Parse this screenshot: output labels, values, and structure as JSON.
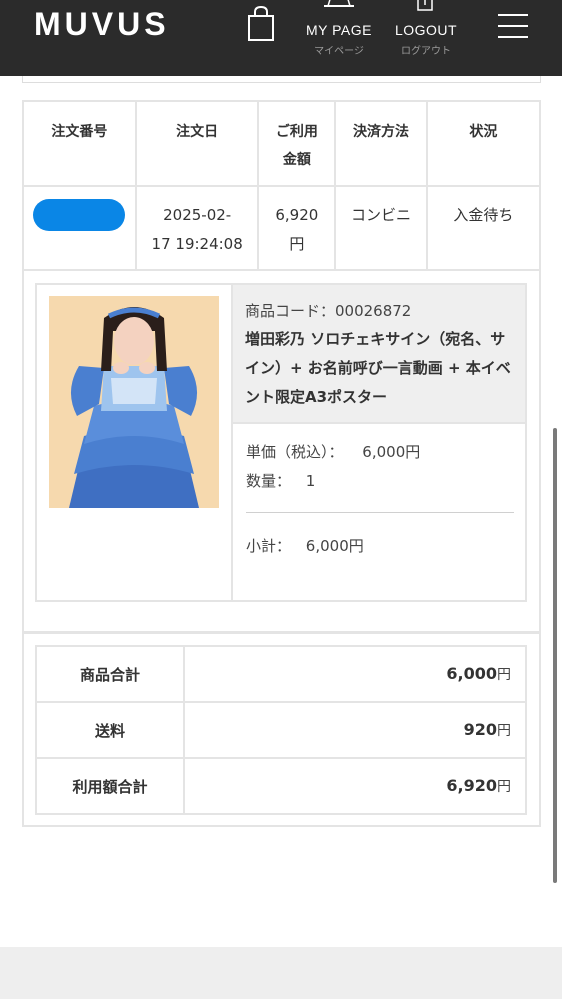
{
  "header": {
    "logo": "MUVUS",
    "mypage_en": "MY PAGE",
    "mypage_jp": "マイページ",
    "logout_en": "LOGOUT",
    "logout_jp": "ログアウト",
    "icons": [
      "shopping-bag-icon",
      "mypage-icon",
      "logout-icon",
      "hamburger-menu-icon"
    ]
  },
  "order": {
    "headers": [
      "注文番号",
      "注文日",
      "ご利用金額",
      "決済方法",
      "状況"
    ],
    "header_lines": {
      "amount_line1": "ご利用",
      "amount_line2": "金額"
    },
    "row": {
      "order_number": "",
      "date_line1": "2025-02-",
      "date_line2": "17 19:24:08",
      "amount_line1": "6,920",
      "amount_line2": "円",
      "payment": "コンビニ",
      "status": "入金待ち"
    }
  },
  "product": {
    "code": "商品コード：00026872",
    "name": "増田彩乃 ソロチェキサイン（宛名、サイン）+ お名前呼び一言動画 + 本イベント限定A3ポスター",
    "unit_price_label": "単価（税込）：",
    "unit_price": "6,000円",
    "quantity_label": "数量：",
    "quantity": "1",
    "subtotal_label": "小計：",
    "subtotal": "6,000円"
  },
  "totals": {
    "items": [
      {
        "label": "商品合計",
        "value": "6,000",
        "unit": "円"
      },
      {
        "label": "送料",
        "value": "920",
        "unit": "円"
      },
      {
        "label": "利用額合計",
        "value": "6,920",
        "unit": "円"
      }
    ]
  },
  "colors": {
    "header_bg": "#2b2b2b",
    "redaction": "#0a86e6",
    "border": "#e4e4e4",
    "info_bg": "#efefef"
  }
}
